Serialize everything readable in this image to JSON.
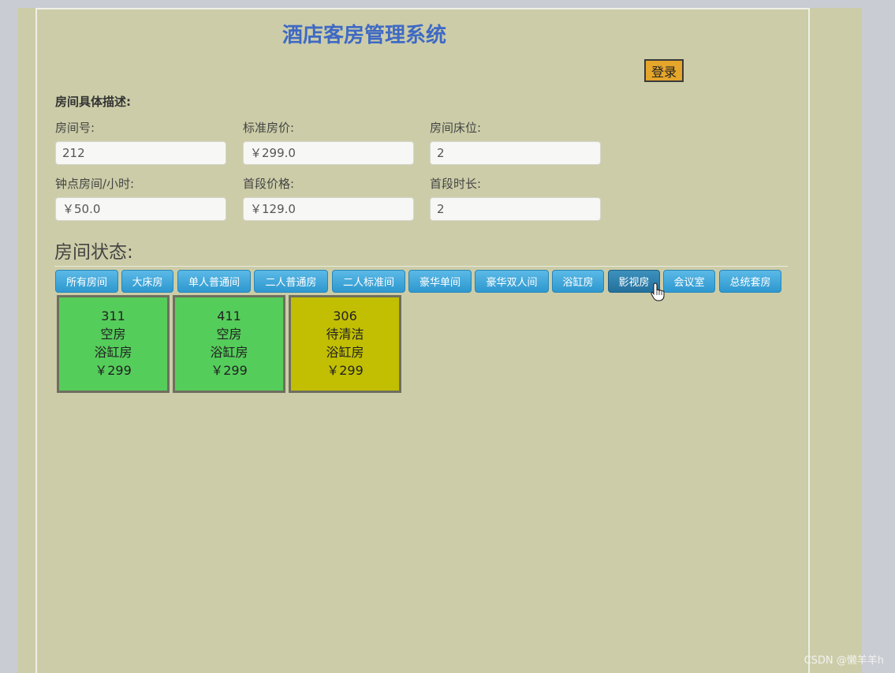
{
  "app": {
    "title": "酒店客房管理系统",
    "login_label": "登录"
  },
  "details": {
    "heading": "房间具体描述:",
    "fields": [
      {
        "label": "房间号:",
        "value": "212"
      },
      {
        "label": "标准房价:",
        "value": "￥299.0"
      },
      {
        "label": "房间床位:",
        "value": "2"
      },
      {
        "label": "钟点房间/小时:",
        "value": "￥50.0"
      },
      {
        "label": "首段价格:",
        "value": "￥129.0"
      },
      {
        "label": "首段时长:",
        "value": "2"
      }
    ]
  },
  "status": {
    "heading": "房间状态:",
    "tabs": [
      {
        "label": "所有房间"
      },
      {
        "label": "大床房"
      },
      {
        "label": "单人普通间"
      },
      {
        "label": "二人普通房"
      },
      {
        "label": "二人标准间"
      },
      {
        "label": "豪华单间"
      },
      {
        "label": "豪华双人间"
      },
      {
        "label": "浴缸房"
      },
      {
        "label": "影视房",
        "active": true
      },
      {
        "label": "会议室"
      },
      {
        "label": "总统套房"
      }
    ],
    "rooms": [
      {
        "number": "311",
        "state": "空房",
        "type": "浴缸房",
        "price": "￥299",
        "color": "#55cd5b"
      },
      {
        "number": "411",
        "state": "空房",
        "type": "浴缸房",
        "price": "￥299",
        "color": "#55cd5b"
      },
      {
        "number": "306",
        "state": "待清洁",
        "type": "浴缸房",
        "price": "￥299",
        "color": "#c2bf02"
      }
    ]
  },
  "watermark": "CSDN @懒羊羊h",
  "icons": {
    "cursor": "hand-pointer-icon"
  }
}
